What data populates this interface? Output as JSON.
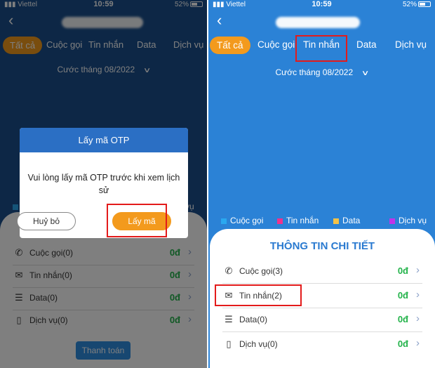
{
  "status": {
    "carrier": "Viettel",
    "time": "10:59",
    "battery": "52%"
  },
  "tabs": [
    "Tất cả",
    "Cuộc gọi",
    "Tin nhắn",
    "Data",
    "Dịch vụ"
  ],
  "period": "Cước tháng 08/2022",
  "legend": [
    {
      "label": "Cuộc gọi",
      "color": "#2aa8f0"
    },
    {
      "label": "Tin nhắn",
      "color": "#f0338c"
    },
    {
      "label": "Data",
      "color": "#f3c247"
    },
    {
      "label": "Dịch vụ",
      "color": "#c034e8"
    }
  ],
  "left_screen": {
    "dialog": {
      "title": "Lấy mã OTP",
      "message": "Vui lòng lấy mã OTP trước khi xem lịch sử",
      "cancel": "Huỷ bỏ",
      "confirm": "Lấy mã"
    },
    "rows": [
      {
        "label": "Cuộc gọi(0)",
        "value": "0đ",
        "icon": "phone-icon"
      },
      {
        "label": "Tin nhắn(0)",
        "value": "0đ",
        "icon": "mail-icon"
      },
      {
        "label": "Data(0)",
        "value": "0đ",
        "icon": "database-icon"
      },
      {
        "label": "Dịch vụ(0)",
        "value": "0đ",
        "icon": "book-icon"
      }
    ],
    "pay_button": "Thanh toán",
    "partial_legend": "vụ"
  },
  "right_screen": {
    "detail_title": "THÔNG TIN CHI TIẾT",
    "rows": [
      {
        "label": "Cuộc gọi(3)",
        "value": "0đ",
        "icon": "phone-icon"
      },
      {
        "label": "Tin nhắn(2)",
        "value": "0đ",
        "icon": "mail-icon"
      },
      {
        "label": "Data(0)",
        "value": "0đ",
        "icon": "database-icon"
      },
      {
        "label": "Dịch vụ(0)",
        "value": "0đ",
        "icon": "book-icon"
      }
    ]
  },
  "accent_colors": {
    "active_tab": "#f39a1d",
    "value_green": "#23b34a",
    "highlight_red": "#e31b1b"
  }
}
